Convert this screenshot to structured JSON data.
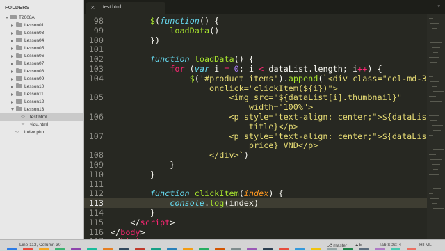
{
  "sidebar": {
    "title": "FOLDERS",
    "tree": [
      {
        "label": "T2008A",
        "kind": "folder",
        "depth": 0,
        "expanded": true
      },
      {
        "label": "Lesson01",
        "kind": "folder",
        "depth": 1,
        "expanded": false
      },
      {
        "label": "Lesson03",
        "kind": "folder",
        "depth": 1,
        "expanded": false
      },
      {
        "label": "Lesson04",
        "kind": "folder",
        "depth": 1,
        "expanded": false
      },
      {
        "label": "Lesson05",
        "kind": "folder",
        "depth": 1,
        "expanded": false
      },
      {
        "label": "Lesson06",
        "kind": "folder",
        "depth": 1,
        "expanded": false
      },
      {
        "label": "Lesson07",
        "kind": "folder",
        "depth": 1,
        "expanded": false
      },
      {
        "label": "Lesson08",
        "kind": "folder",
        "depth": 1,
        "expanded": false
      },
      {
        "label": "Lesson09",
        "kind": "folder",
        "depth": 1,
        "expanded": false
      },
      {
        "label": "Lesson10",
        "kind": "folder",
        "depth": 1,
        "expanded": false
      },
      {
        "label": "Lesson11",
        "kind": "folder",
        "depth": 1,
        "expanded": false
      },
      {
        "label": "Lesson12",
        "kind": "folder",
        "depth": 1,
        "expanded": false
      },
      {
        "label": "Lesson13",
        "kind": "folder",
        "depth": 1,
        "expanded": true
      },
      {
        "label": "test.html",
        "kind": "file",
        "depth": 2,
        "selected": true
      },
      {
        "label": "vidu.html",
        "kind": "file",
        "depth": 2
      },
      {
        "label": "index.php",
        "kind": "file",
        "depth": 1
      }
    ]
  },
  "tabs": [
    {
      "label": "test.html",
      "active": true,
      "close_icon": "×"
    }
  ],
  "tabbar": {
    "overflow_icon": "▾"
  },
  "editor": {
    "current_line": 113,
    "lines": [
      {
        "n": "98",
        "tokens": [
          [
            "",
            "        "
          ],
          [
            "fn",
            "$"
          ],
          [
            "",
            "("
          ],
          [
            "ty",
            "function"
          ],
          [
            "",
            "() {"
          ]
        ]
      },
      {
        "n": "99",
        "tokens": [
          [
            "",
            "            "
          ],
          [
            "fn",
            "loadData"
          ],
          [
            "",
            "()"
          ]
        ]
      },
      {
        "n": "100",
        "tokens": [
          [
            "",
            "        })"
          ]
        ]
      },
      {
        "n": "101",
        "tokens": [
          [
            "",
            ""
          ]
        ]
      },
      {
        "n": "102",
        "tokens": [
          [
            "",
            "        "
          ],
          [
            "ty",
            "function"
          ],
          [
            "",
            " "
          ],
          [
            "fn",
            "loadData"
          ],
          [
            "",
            "() {"
          ]
        ]
      },
      {
        "n": "103",
        "tokens": [
          [
            "",
            "            "
          ],
          [
            "kw",
            "for"
          ],
          [
            "",
            " ("
          ],
          [
            "ty",
            "var"
          ],
          [
            "",
            " i "
          ],
          [
            "kw",
            "="
          ],
          [
            "",
            " "
          ],
          [
            "nu",
            "0"
          ],
          [
            "",
            "; i "
          ],
          [
            "kw",
            "<"
          ],
          [
            "",
            " dataList.length; i"
          ],
          [
            "kw",
            "++"
          ],
          [
            "",
            ") {"
          ]
        ]
      },
      {
        "n": "104",
        "tokens": [
          [
            "",
            "                "
          ],
          [
            "fn",
            "$"
          ],
          [
            "",
            "("
          ],
          [
            "st",
            "'#product_items'"
          ],
          [
            "",
            ")."
          ],
          [
            "fn",
            "append"
          ],
          [
            "",
            "("
          ],
          [
            "st",
            "`<div class=\"col-md-3\""
          ]
        ]
      },
      {
        "n": "",
        "tokens": [
          [
            "st",
            "                    onclick=\"clickItem(${i})\">"
          ]
        ]
      },
      {
        "n": "105",
        "tokens": [
          [
            "st",
            "                        <img src=\"${dataList[i].thumbnail}\""
          ]
        ]
      },
      {
        "n": "",
        "tokens": [
          [
            "st",
            "                            width=\"100%\">"
          ]
        ]
      },
      {
        "n": "106",
        "tokens": [
          [
            "st",
            "                        <p style=\"text-align: center;\">${dataList[i]."
          ]
        ]
      },
      {
        "n": "",
        "tokens": [
          [
            "st",
            "                            title}</p>"
          ]
        ]
      },
      {
        "n": "107",
        "tokens": [
          [
            "st",
            "                        <p style=\"text-align: center;\">${dataList[i]."
          ]
        ]
      },
      {
        "n": "",
        "tokens": [
          [
            "st",
            "                            price} VND</p>"
          ]
        ]
      },
      {
        "n": "108",
        "tokens": [
          [
            "st",
            "                    </div>`"
          ],
          [
            "",
            ")"
          ]
        ]
      },
      {
        "n": "109",
        "tokens": [
          [
            "",
            "            }"
          ]
        ]
      },
      {
        "n": "110",
        "tokens": [
          [
            "",
            "        }"
          ]
        ]
      },
      {
        "n": "111",
        "tokens": [
          [
            "",
            ""
          ]
        ]
      },
      {
        "n": "112",
        "tokens": [
          [
            "",
            "        "
          ],
          [
            "ty",
            "function"
          ],
          [
            "",
            " "
          ],
          [
            "fn",
            "clickItem"
          ],
          [
            "",
            "("
          ],
          [
            "pa",
            "index"
          ],
          [
            "",
            ") {"
          ]
        ]
      },
      {
        "n": "113",
        "tokens": [
          [
            "",
            "            "
          ],
          [
            "ty",
            "console"
          ],
          [
            "",
            "."
          ],
          [
            "fn",
            "log"
          ],
          [
            "",
            "(index)"
          ]
        ]
      },
      {
        "n": "114",
        "tokens": [
          [
            "",
            "        }"
          ]
        ]
      },
      {
        "n": "115",
        "tokens": [
          [
            "",
            "    </"
          ],
          [
            "kw",
            "script"
          ],
          [
            "",
            ">"
          ]
        ]
      },
      {
        "n": "116",
        "tokens": [
          [
            "",
            "</"
          ],
          [
            "kw",
            "body"
          ],
          [
            "",
            ">"
          ]
        ]
      },
      {
        "n": "117",
        "tokens": [
          [
            "",
            "</"
          ],
          [
            "kw",
            "html"
          ],
          [
            "",
            ">"
          ]
        ]
      }
    ]
  },
  "statusbar": {
    "position": "Line 113, Column 30",
    "branch": "master",
    "file_count": "5",
    "tab_size": "Tab Size: 4",
    "syntax": "HTML"
  },
  "colors": {
    "editor_bg": "#272822",
    "keyword": "#f92672",
    "function": "#a6e22e",
    "type": "#66d9ef",
    "string": "#e6db74",
    "number": "#ae81ff",
    "param": "#fd971f"
  }
}
